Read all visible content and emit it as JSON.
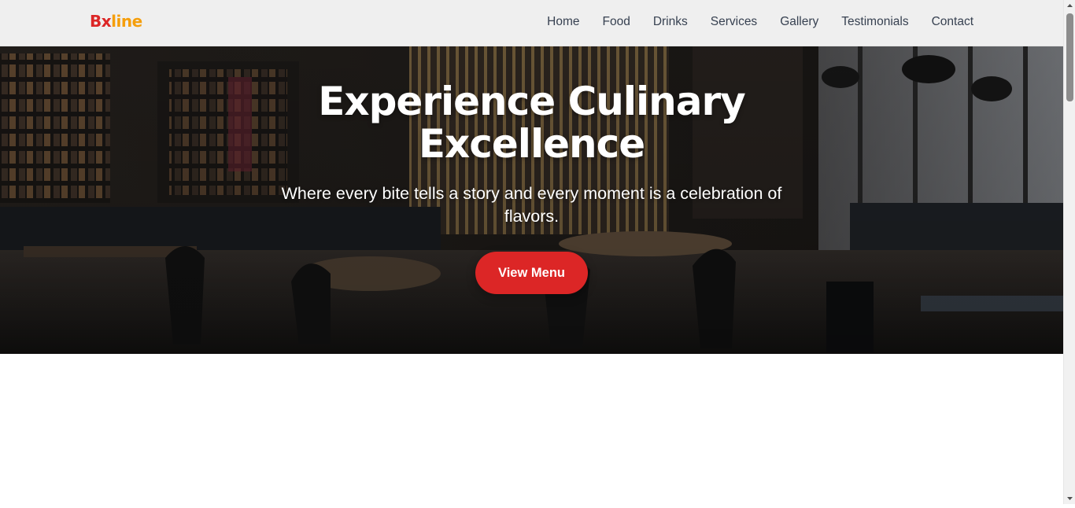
{
  "brand": {
    "part1": "Bx",
    "part2": "line",
    "color_primary": "#dc2626",
    "color_secondary": "#f59e0b"
  },
  "nav": {
    "items": [
      {
        "label": "Home"
      },
      {
        "label": "Food"
      },
      {
        "label": "Drinks"
      },
      {
        "label": "Services"
      },
      {
        "label": "Gallery"
      },
      {
        "label": "Testimonials"
      },
      {
        "label": "Contact"
      }
    ]
  },
  "hero": {
    "title": "Experience Culinary Excellence",
    "subtitle": "Where every bite tells a story and every moment is a celebration of flavors.",
    "button_label": "View Menu",
    "button_color": "#dc2626",
    "background_image": "restaurant-interior-photo"
  },
  "scrollbar": {
    "up_icon": "scroll-up-arrow-icon",
    "down_icon": "scroll-down-arrow-icon"
  }
}
